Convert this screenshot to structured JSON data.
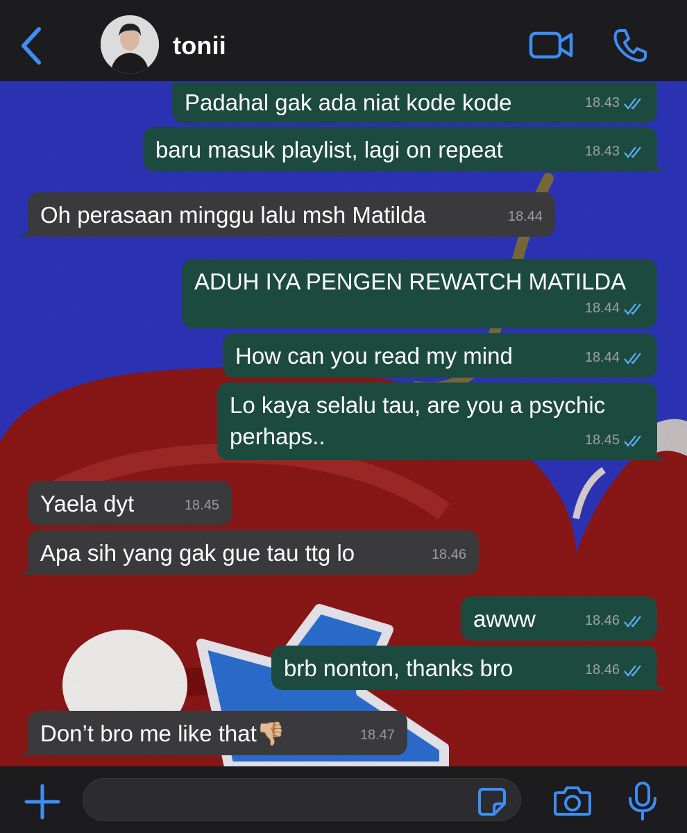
{
  "header": {
    "contact_name": "tonii",
    "back_icon": "chevron-left-icon",
    "video_icon": "video-camera-icon",
    "phone_icon": "phone-icon"
  },
  "colors": {
    "accent": "#3d8ef7",
    "outgoing_bubble": "#1d4a3f",
    "incoming_bubble": "#3a3a3c",
    "wallpaper_blue": "#2e34b9",
    "wallpaper_red": "#8c1515"
  },
  "messages": [
    {
      "direction": "out",
      "text": "Padahal gak ada niat kode kode",
      "time": "18.43",
      "read": true
    },
    {
      "direction": "out",
      "text": "baru masuk playlist, lagi on repeat",
      "time": "18.43",
      "read": true
    },
    {
      "direction": "in",
      "text": "Oh perasaan minggu lalu msh Matilda",
      "time": "18.44"
    },
    {
      "direction": "out",
      "text": "ADUH IYA PENGEN REWATCH MATILDA",
      "time": "18.44",
      "read": true
    },
    {
      "direction": "out",
      "text": "How can you read my mind",
      "time": "18.44",
      "read": true
    },
    {
      "direction": "out",
      "text_line1": "Lo kaya selalu tau, are you a psychic",
      "text_line2": "perhaps..",
      "time": "18.45",
      "read": true
    },
    {
      "direction": "in",
      "text": "Yaela dyt",
      "time": "18.45"
    },
    {
      "direction": "in",
      "text": "Apa sih yang gak gue tau ttg lo",
      "time": "18.46"
    },
    {
      "direction": "out",
      "text": "awww",
      "time": "18.46",
      "read": true
    },
    {
      "direction": "out",
      "text": "brb nonton, thanks bro",
      "time": "18.46",
      "read": true
    },
    {
      "direction": "in",
      "text": "Don’t bro me like that👎🏼",
      "time": "18.47"
    }
  ],
  "composer": {
    "plus_icon": "plus-icon",
    "sticker_icon": "sticker-icon",
    "camera_icon": "camera-icon",
    "mic_icon": "microphone-icon"
  }
}
